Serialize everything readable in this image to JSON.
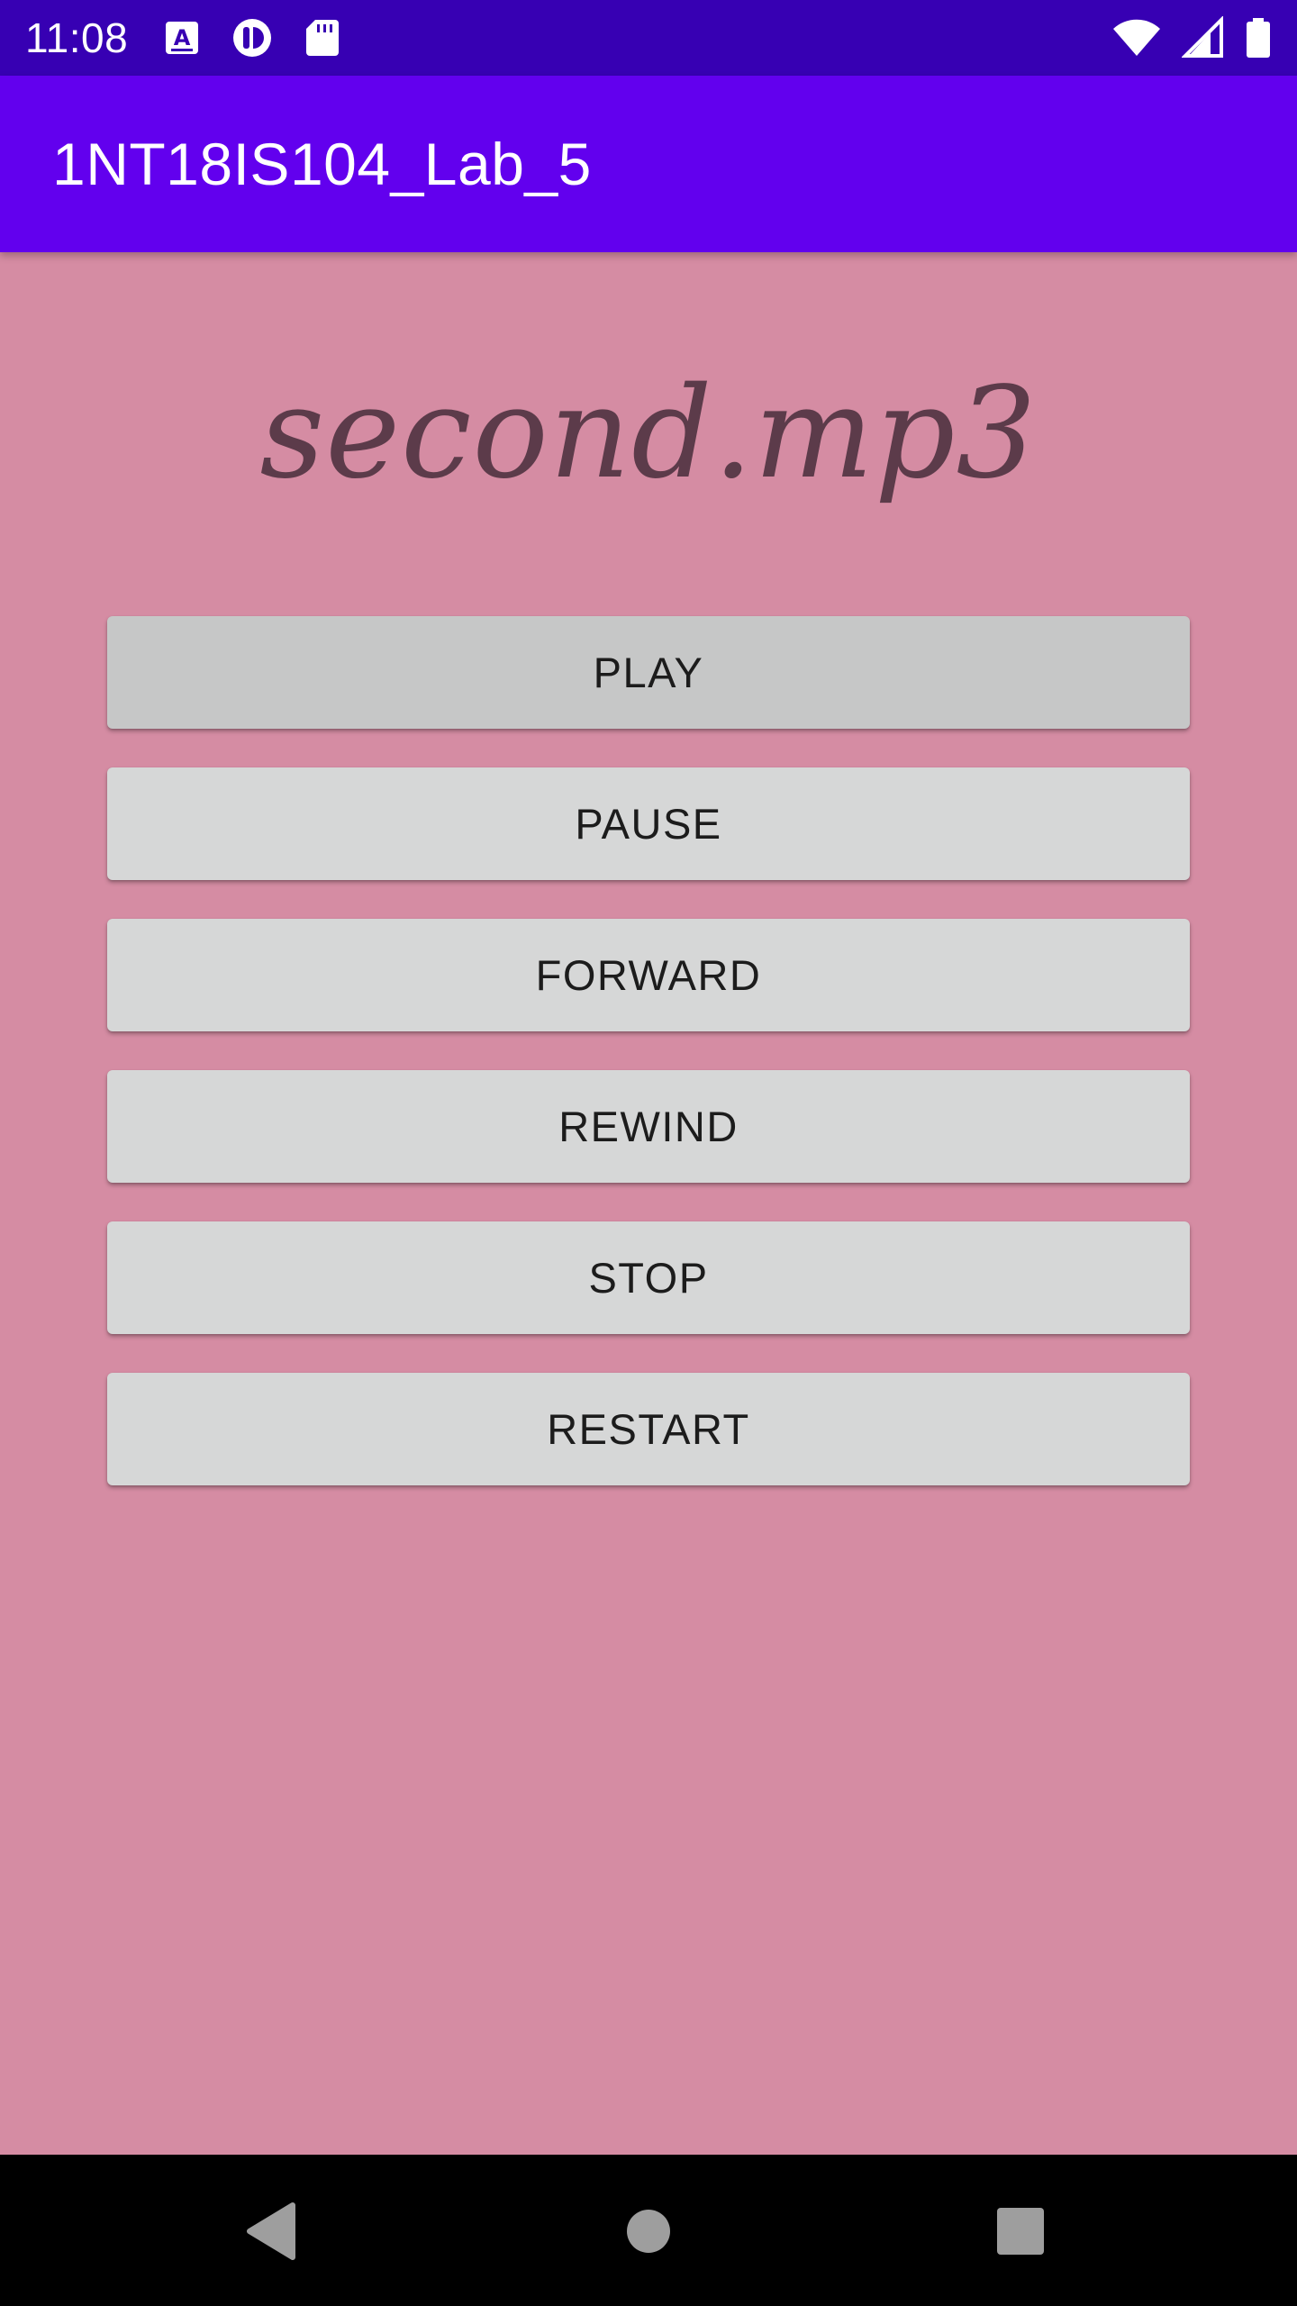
{
  "status_bar": {
    "time": "11:08",
    "left_icons": [
      "a-keyboard-icon",
      "app-notification-icon",
      "sd-card-icon"
    ],
    "right_icons": [
      "wifi-icon",
      "cellular-signal-icon",
      "battery-icon"
    ]
  },
  "app_bar": {
    "title": "1NT18IS104_Lab_5"
  },
  "player": {
    "track_title": "second.mp3",
    "buttons": [
      {
        "id": "play",
        "label": "PLAY"
      },
      {
        "id": "pause",
        "label": "PAUSE"
      },
      {
        "id": "forward",
        "label": "FORWARD"
      },
      {
        "id": "rewind",
        "label": "REWIND"
      },
      {
        "id": "stop",
        "label": "STOP"
      },
      {
        "id": "restart",
        "label": "RESTART"
      }
    ]
  },
  "nav_bar": {
    "icons": [
      "back-icon",
      "home-icon",
      "recents-icon"
    ]
  },
  "colors": {
    "status_bar": "#3700b3",
    "app_bar": "#6200ee",
    "background": "#d58ca3",
    "button": "#d6d7d7",
    "button_pressed": "#c6c7c7",
    "track_title": "#5c3b4a"
  }
}
